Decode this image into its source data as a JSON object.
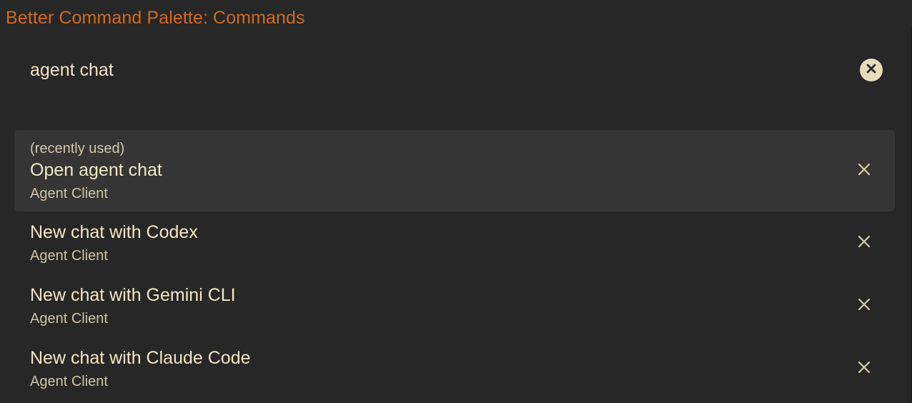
{
  "header": {
    "title": "Better Command Palette: Commands"
  },
  "search": {
    "value": "agent chat",
    "clear_icon": "close-circle-icon"
  },
  "results": [
    {
      "note": "(recently used)",
      "title": "Open agent chat",
      "subtitle": "Agent Client",
      "selected": true,
      "remove_icon": "close-icon"
    },
    {
      "note": "",
      "title": "New chat with Codex",
      "subtitle": "Agent Client",
      "selected": false,
      "remove_icon": "close-icon"
    },
    {
      "note": "",
      "title": "New chat with Gemini CLI",
      "subtitle": "Agent Client",
      "selected": false,
      "remove_icon": "close-icon"
    },
    {
      "note": "",
      "title": "New chat with Claude Code",
      "subtitle": "Agent Client",
      "selected": false,
      "remove_icon": "close-icon"
    }
  ],
  "colors": {
    "title_accent": "#d2691e",
    "text_primary": "#f3e7c2",
    "text_secondary": "#cfc3a4",
    "selected_background": "#353535",
    "background": "#272727"
  }
}
